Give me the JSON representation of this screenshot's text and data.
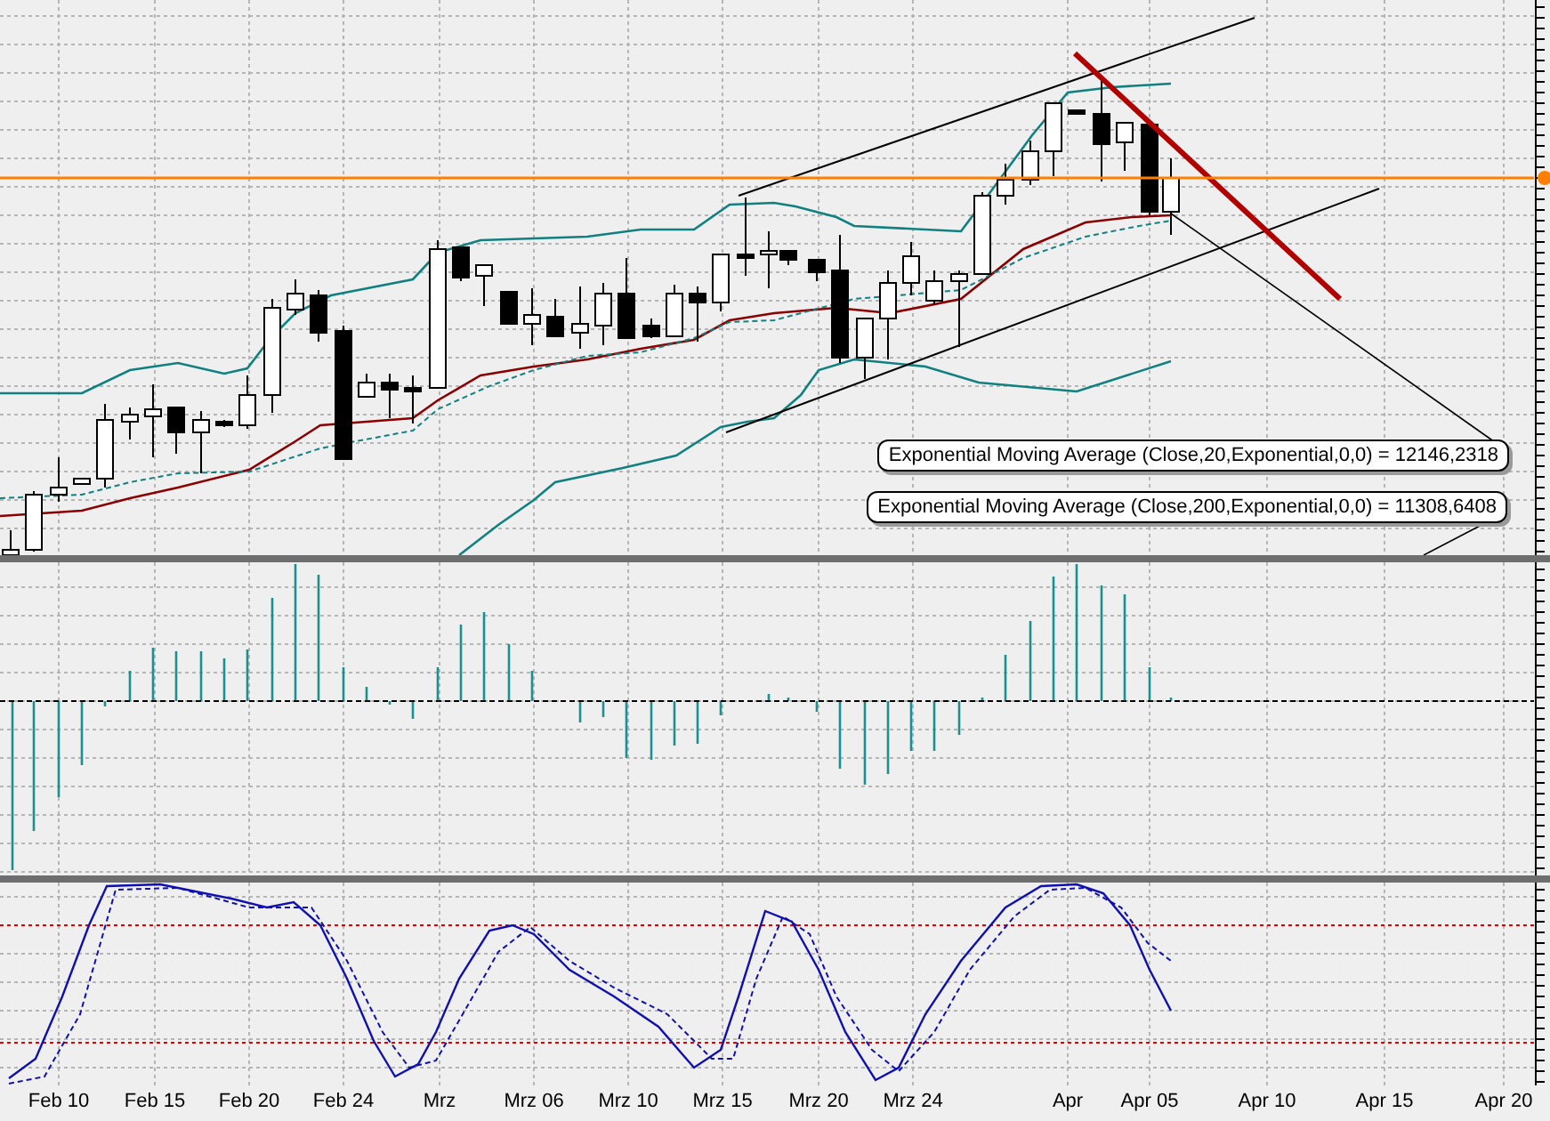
{
  "price_panel": {
    "indicator_labels": [
      "Exponential Moving Average (Close,20,Exponential,0,0) = 12146,2318",
      "Exponential Moving Average (Close,200,Exponential,0,0) = 11308,6408"
    ]
  },
  "x_axis": {
    "labels": [
      "Feb 10",
      "Feb 15",
      "Feb 20",
      "Feb 24",
      "Mrz",
      "Mrz 06",
      "Mrz 10",
      "Mrz 15",
      "Mrz 20",
      "Mrz 24",
      "Apr",
      "Apr 05",
      "Apr 10",
      "Apr 15",
      "Apr 20"
    ]
  }
}
